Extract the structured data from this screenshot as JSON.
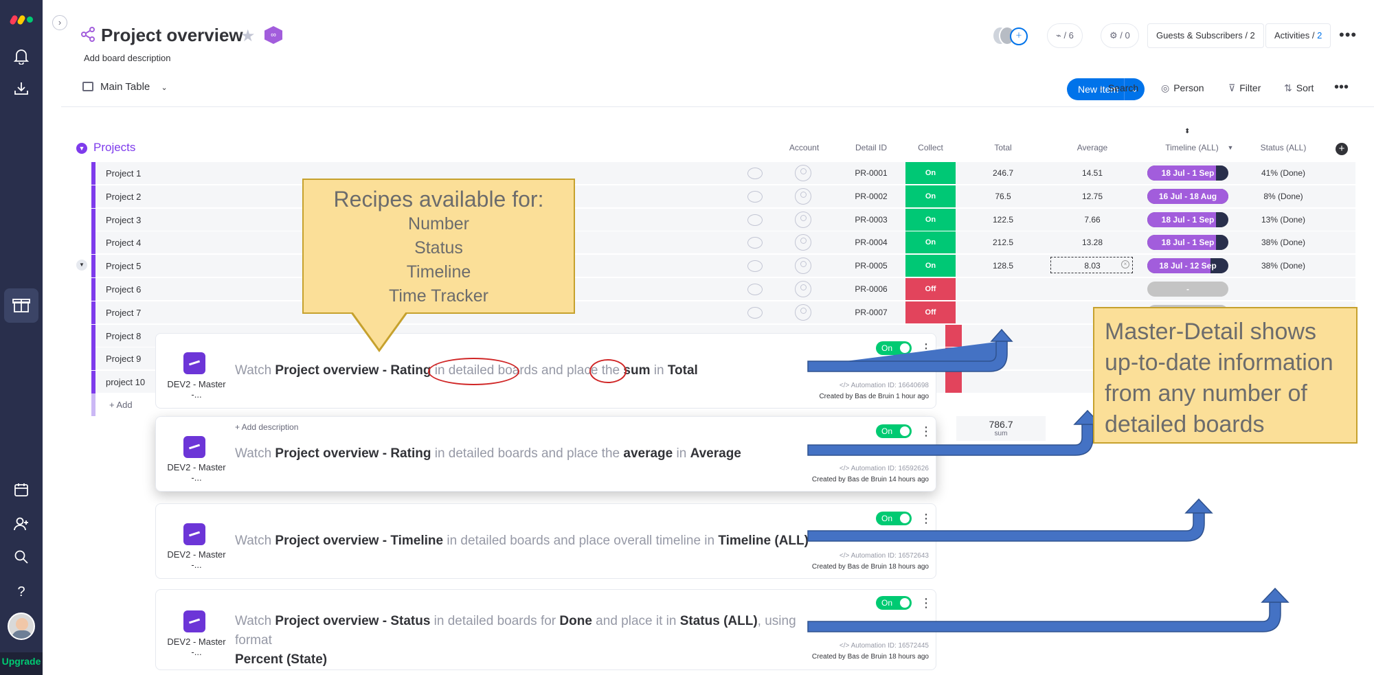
{
  "rail": {
    "upgrade": "Upgrade",
    "icons": [
      "monday-logo-icon",
      "bell-icon",
      "inbox-download-icon",
      "gift-icon",
      "calendar-icon",
      "invite-person-icon",
      "search-icon",
      "help-icon"
    ]
  },
  "header": {
    "title": "Project overview",
    "description": "Add board description",
    "integrations": "/ 6",
    "automations": "/ 0",
    "guests": "Guests & Subscribers / 2",
    "activities_label": "Activities / ",
    "activities_count": "2"
  },
  "toolbar": {
    "view": "Main Table",
    "new_item": "New Item",
    "search": "Search",
    "person": "Person",
    "filter": "Filter",
    "sort": "Sort"
  },
  "group": {
    "title": "Projects",
    "columns": [
      "Account",
      "Detail ID",
      "Collect",
      "Total",
      "Average",
      "Timeline (ALL)",
      "Status (ALL)"
    ],
    "add_item": "+ Add",
    "footer_total": "786.7",
    "footer_total_label": "sum"
  },
  "rows": [
    {
      "name": "Project 1",
      "id": "PR-0001",
      "collect": "On",
      "total": "246.7",
      "average": "14.51",
      "timeline": "18 Jul - 1 Sep",
      "status": "41% (Done)"
    },
    {
      "name": "Project 2",
      "id": "PR-0002",
      "collect": "On",
      "total": "76.5",
      "average": "12.75",
      "timeline": "16 Jul - 18 Aug",
      "status": "8% (Done)"
    },
    {
      "name": "Project 3",
      "id": "PR-0003",
      "collect": "On",
      "total": "122.5",
      "average": "7.66",
      "timeline": "18 Jul - 1 Sep",
      "status": "13% (Done)"
    },
    {
      "name": "Project 4",
      "id": "PR-0004",
      "collect": "On",
      "total": "212.5",
      "average": "13.28",
      "timeline": "18 Jul - 1 Sep",
      "status": "38% (Done)"
    },
    {
      "name": "Project 5",
      "id": "PR-0005",
      "collect": "On",
      "total": "128.5",
      "average": "8.03",
      "timeline": "18 Jul - 12 Sep",
      "status": "38% (Done)"
    },
    {
      "name": "Project 6",
      "id": "PR-0006",
      "collect": "Off",
      "total": "",
      "average": "",
      "timeline": "-",
      "status": ""
    },
    {
      "name": "Project 7",
      "id": "PR-0007",
      "collect": "Off",
      "total": "",
      "average": "",
      "timeline": "",
      "status": ""
    },
    {
      "name": "Project 8"
    },
    {
      "name": "Project 9"
    },
    {
      "name": "project 10"
    }
  ],
  "timeline_fill": [
    0.85,
    1.0,
    0.85,
    0.85,
    0.78,
    0,
    0
  ],
  "colors": {
    "accent": "#0073ea",
    "on": "#00c875",
    "off": "#e2445c",
    "timeline": "#a25ddc",
    "group": "#7e3bec",
    "callout": "#fbdf98"
  },
  "callout_left": {
    "heading": "Recipes available for:",
    "items": [
      "Number",
      "Status",
      "Timeline",
      "Time Tracker"
    ]
  },
  "callout_right": {
    "text": "Master-Detail shows up-to-date information from any number of detailed boards"
  },
  "cards": [
    {
      "app": "DEV2 - Master -...",
      "s1": "Watch ",
      "b1": "Project overview - Rating",
      "s2": " in ",
      "s3": "detailed boards",
      "s4": " and place the ",
      "b2": "sum",
      "s5": " in ",
      "b3": "Total",
      "toggle": "On",
      "automation_id": "</> Automation ID: 16640698",
      "created": "Created by Bas de Bruin 1 hour ago"
    },
    {
      "app": "DEV2 - Master -...",
      "desc": "+ Add description",
      "s1": "Watch ",
      "b1": "Project overview - Rating",
      "s2": " in detailed boards and place the ",
      "b2": "average",
      "s3": " in ",
      "b3": "Average",
      "toggle": "On",
      "automation_id": "</> Automation ID: 16592626",
      "created": "Created by Bas de Bruin 14 hours ago"
    },
    {
      "app": "DEV2 - Master -...",
      "s1": "Watch ",
      "b1": "Project overview - Timeline",
      "s2": " in detailed boards and place overall timeline in ",
      "b2": "Timeline (ALL)",
      "toggle": "On",
      "automation_id": "</> Automation ID: 16572643",
      "created": "Created by Bas de Bruin 18 hours ago"
    },
    {
      "app": "DEV2 - Master -...",
      "s1": "Watch ",
      "b1": "Project overview - Status",
      "s2": " in detailed boards for ",
      "b2": "Done",
      "s3": " and place it in ",
      "b3": "Status (ALL)",
      "s4": ", using format ",
      "b4": "Percent (State)",
      "toggle": "On",
      "automation_id": "</> Automation ID: 16572445",
      "created": "Created by Bas de Bruin 18 hours ago"
    }
  ]
}
